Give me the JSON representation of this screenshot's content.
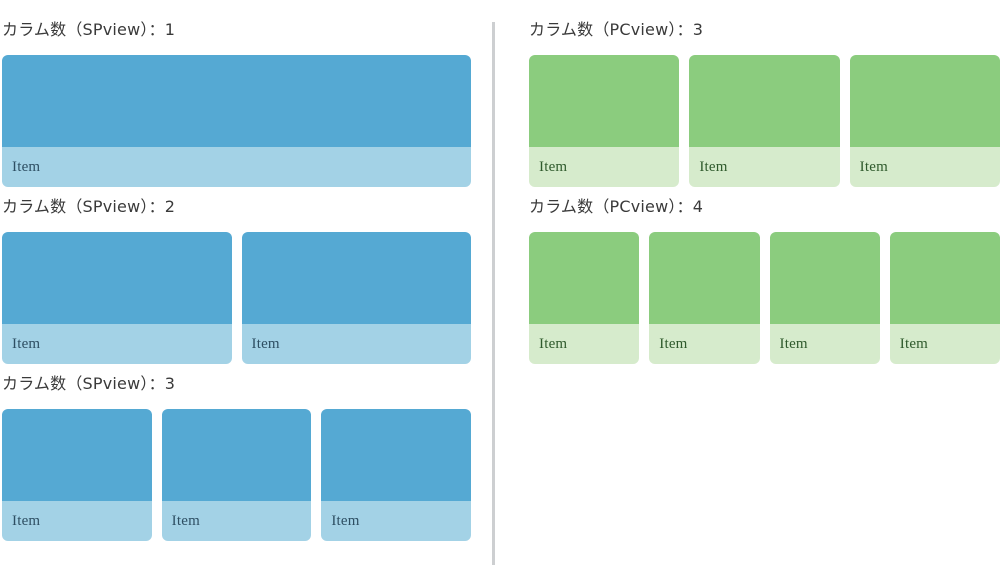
{
  "theme": {
    "blue_dark": "#55a9d3",
    "blue_light": "#a3d2e6",
    "blue_text": "#2e4f63",
    "green_dark": "#8bcc7e",
    "green_light": "#d6ebcc",
    "green_text": "#2f5a2c",
    "heading_text": "#3a3a3a",
    "divider": "#cdcfd1"
  },
  "left_pane": {
    "sections": [
      {
        "title": "カラム数（SPview）：1",
        "columns": 1,
        "items": [
          {
            "label": "Item"
          }
        ]
      },
      {
        "title": "カラム数（SPview）：2",
        "columns": 2,
        "items": [
          {
            "label": "Item"
          },
          {
            "label": "Item"
          }
        ]
      },
      {
        "title": "カラム数（SPview）：3",
        "columns": 3,
        "items": [
          {
            "label": "Item"
          },
          {
            "label": "Item"
          },
          {
            "label": "Item"
          }
        ]
      }
    ]
  },
  "right_pane": {
    "sections": [
      {
        "title": "カラム数（PCview）：3",
        "columns": 3,
        "items": [
          {
            "label": "Item"
          },
          {
            "label": "Item"
          },
          {
            "label": "Item"
          }
        ]
      },
      {
        "title": "カラム数（PCview）：4",
        "columns": 4,
        "items": [
          {
            "label": "Item"
          },
          {
            "label": "Item"
          },
          {
            "label": "Item"
          },
          {
            "label": "Item"
          }
        ]
      }
    ]
  }
}
